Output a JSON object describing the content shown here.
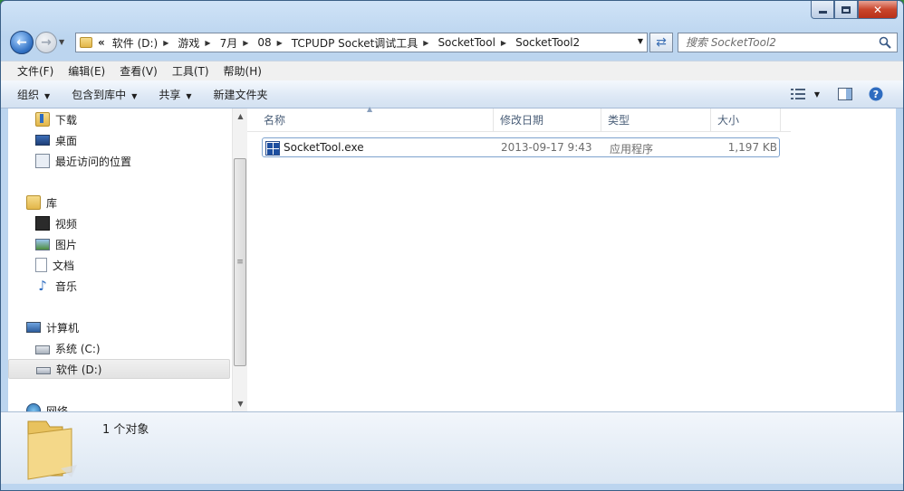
{
  "window": {
    "caption": {
      "minimize": "",
      "maximize": "",
      "close": "✕"
    }
  },
  "address": {
    "overflow": "«",
    "crumbs": [
      "软件 (D:)",
      "游戏",
      "7月",
      "08",
      "TCPUDP Socket调试工具",
      "SocketTool",
      "SocketTool2"
    ]
  },
  "search": {
    "placeholder": "搜索 SocketTool2"
  },
  "menu": [
    "文件(F)",
    "编辑(E)",
    "查看(V)",
    "工具(T)",
    "帮助(H)"
  ],
  "commands": {
    "organize": "组织",
    "include_in_library": "包含到库中",
    "share": "共享",
    "new_folder": "新建文件夹"
  },
  "nav": {
    "downloads": "下载",
    "desktop": "桌面",
    "recent": "最近访问的位置",
    "libraries": "库",
    "videos": "视频",
    "pictures": "图片",
    "documents": "文档",
    "music": "音乐",
    "computer": "计算机",
    "drive_c": "系统 (C:)",
    "drive_d": "软件 (D:)",
    "network": "网络"
  },
  "columns": {
    "name": "名称",
    "modified": "修改日期",
    "type": "类型",
    "size": "大小"
  },
  "files": [
    {
      "name": "SocketTool.exe",
      "modified": "2013-09-17 9:43",
      "type": "应用程序",
      "size": "1,197 KB"
    }
  ],
  "details": {
    "count": "1 个对象"
  },
  "colors": {
    "selection_border": "#7da2ce",
    "accent": "#3372c4"
  }
}
